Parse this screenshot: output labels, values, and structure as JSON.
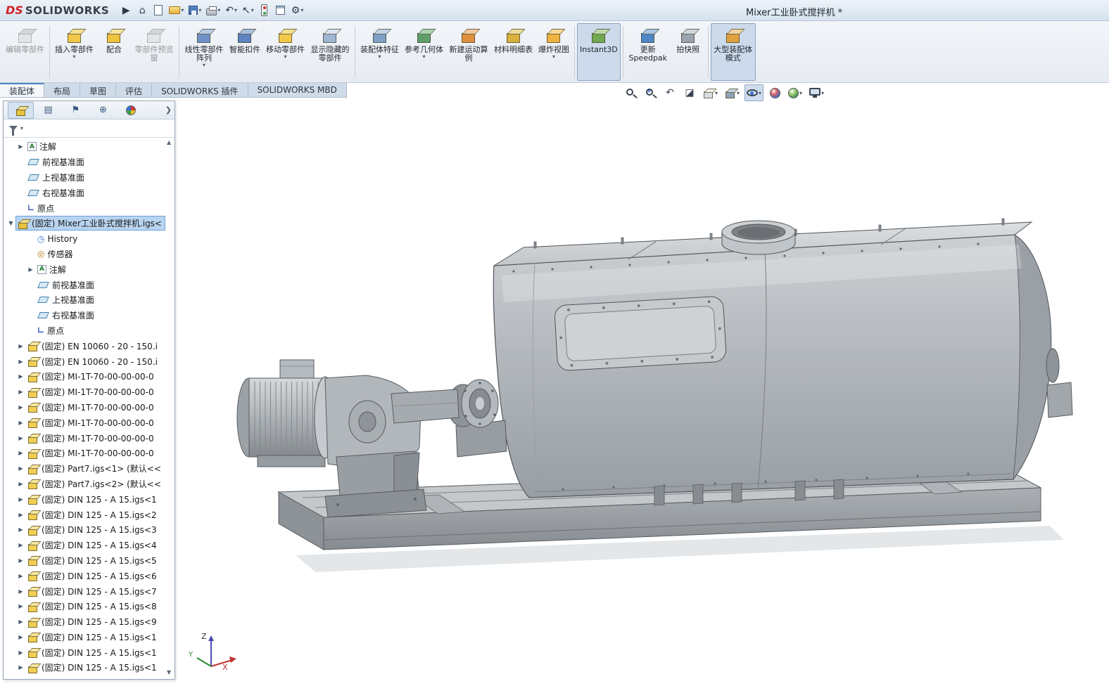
{
  "titlebar": {
    "brand_prefix": "DS",
    "brand": "SOLIDWORKS",
    "doc_title": "Mixer工业卧式搅拌机 *",
    "tools": [
      {
        "name": "toolbar-expand-icon",
        "type": "glyph",
        "g": "▶"
      },
      {
        "name": "home-icon",
        "type": "glyph",
        "g": "⌂"
      },
      {
        "name": "new-document-icon",
        "type": "doc"
      },
      {
        "name": "open-document-icon",
        "type": "folder",
        "caret": true
      },
      {
        "name": "save-icon",
        "type": "save",
        "caret": true
      },
      {
        "name": "print-icon",
        "type": "print",
        "caret": true
      },
      {
        "name": "undo-icon",
        "type": "glyph",
        "g": "↶",
        "caret": true
      },
      {
        "name": "select-icon",
        "type": "glyph",
        "g": "↖",
        "caret": true
      },
      {
        "name": "rebuild-icon",
        "type": "traffic"
      },
      {
        "name": "file-properties-icon",
        "type": "propbox"
      },
      {
        "name": "options-icon",
        "type": "glyph",
        "g": "⚙",
        "caret": true
      }
    ]
  },
  "icons": {
    "expand": "▶",
    "collapse": "▼",
    "caret": "▾",
    "scroll_up": "▲",
    "scroll_down": "▼"
  },
  "ribbon": {
    "separators": [
      0,
      3,
      7,
      12,
      13,
      15
    ],
    "buttons": [
      {
        "name": "edit-component-button",
        "label": "编辑零部件",
        "disabled": true,
        "c1": "#cfd6de",
        "c2": "#aab4c0"
      },
      {
        "name": "insert-components-button",
        "label": "插入零部件",
        "dropdown": true,
        "c1": "#f2c84b",
        "c2": "#f7e08e"
      },
      {
        "name": "mate-button",
        "label": "配合",
        "c1": "#f0c23e",
        "c2": "#f8e49a"
      },
      {
        "name": "component-preview-window-button",
        "label": "零部件预览窗",
        "disabled": true,
        "c1": "#cfd6de",
        "c2": "#aab4c0"
      },
      {
        "name": "linear-component-pattern-button",
        "label": "线性零部件阵列",
        "dropdown": true,
        "c1": "#6f93c9",
        "c2": "#b8cbe6"
      },
      {
        "name": "smart-fasteners-button",
        "label": "智能扣件",
        "c1": "#5c84c0",
        "c2": "#a9c0de"
      },
      {
        "name": "move-component-button",
        "label": "移动零部件",
        "dropdown": true,
        "c1": "#f2c84b",
        "c2": "#f7e08e"
      },
      {
        "name": "show-hidden-components-button",
        "label": "显示隐藏的零部件",
        "c1": "#9fb6d4",
        "c2": "#dce6f2"
      },
      {
        "name": "assembly-features-button",
        "label": "装配体特征",
        "dropdown": true,
        "c1": "#7f9fc7",
        "c2": "#c3d3e8"
      },
      {
        "name": "reference-geometry-button",
        "label": "参考几何体",
        "dropdown": true,
        "c1": "#5fa06a",
        "c2": "#abd3b1"
      },
      {
        "name": "new-motion-study-button",
        "label": "新建运动算例",
        "c1": "#e08f3c",
        "c2": "#f2c89a"
      },
      {
        "name": "bill-of-materials-button",
        "label": "材料明细表",
        "c1": "#d9b13a",
        "c2": "#efdc9a"
      },
      {
        "name": "exploded-view-button",
        "label": "爆炸视图",
        "dropdown": true,
        "c1": "#efb23f",
        "c2": "#f8d98f"
      },
      {
        "name": "instant3d-button",
        "label": "Instant3D",
        "active": true,
        "c1": "#72a84f",
        "c2": "#bcd9a6"
      },
      {
        "name": "update-speedpak-button",
        "label": "更新Speedpak",
        "c1": "#4f86c6",
        "c2": "#a9c6e4"
      },
      {
        "name": "take-snapshot-button",
        "label": "拍快照",
        "c1": "#9aa4ae",
        "c2": "#cfd6dd"
      },
      {
        "name": "large-assembly-mode-button",
        "label": "大型装配体模式",
        "active": true,
        "c1": "#e0a23c",
        "c2": "#f2d49a"
      }
    ]
  },
  "command_tabs": [
    {
      "name": "tab-assembly",
      "label": "装配体",
      "active": true
    },
    {
      "name": "tab-layout",
      "label": "布局"
    },
    {
      "name": "tab-sketch",
      "label": "草图"
    },
    {
      "name": "tab-evaluate",
      "label": "评估"
    },
    {
      "name": "tab-solidworks-addins",
      "label": "SOLIDWORKS 插件"
    },
    {
      "name": "tab-solidworks-mbd",
      "label": "SOLIDWORKS MBD"
    }
  ],
  "viewport": {
    "triad": {
      "x": "X",
      "y": "Y",
      "z": "Z"
    },
    "headsup": [
      {
        "name": "zoom-to-fit-icon",
        "icon": "mag"
      },
      {
        "name": "zoom-to-area-icon",
        "icon": "magplus"
      },
      {
        "name": "previous-view-icon",
        "icon": "glyph",
        "g": "↶"
      },
      {
        "name": "section-view-icon",
        "icon": "glyph",
        "g": "◪"
      },
      {
        "name": "view-orientation-icon",
        "icon": "cube",
        "caret": true,
        "c1": "#d8dee6",
        "c2": "#eef2f6"
      },
      {
        "name": "display-style-icon",
        "icon": "cube",
        "caret": true,
        "c1": "#8fa3b8",
        "c2": "#c6d4e2"
      },
      {
        "name": "hide-show-items-icon",
        "icon": "eye",
        "caret": true,
        "pressed": true
      },
      {
        "name": "edit-appearance-icon",
        "icon": "ball"
      },
      {
        "name": "apply-scene-icon",
        "icon": "scene",
        "caret": true
      },
      {
        "name": "view-settings-icon",
        "icon": "monitor",
        "caret": true
      }
    ]
  },
  "panel": {
    "chevron": "❯",
    "tabs": [
      {
        "name": "tab-featuremanager",
        "icon": "asmcube",
        "active": true
      },
      {
        "name": "tab-propertymanager",
        "icon": "glyph",
        "g": "▤"
      },
      {
        "name": "tab-configurationmanager",
        "icon": "glyph",
        "g": "⚑"
      },
      {
        "name": "tab-dimxpertmanager",
        "icon": "glyph",
        "g": "⊕"
      },
      {
        "name": "tab-displaymanager",
        "icon": "disp"
      }
    ],
    "tree": [
      {
        "label": "注解",
        "icon": "ann",
        "level": 1,
        "arrow": "r"
      },
      {
        "label": "前视基准面",
        "icon": "plane",
        "level": 1
      },
      {
        "label": "上视基准面",
        "icon": "plane",
        "level": 1
      },
      {
        "label": "右视基准面",
        "icon": "plane",
        "level": 1
      },
      {
        "label": "原点",
        "icon": "origin",
        "level": 1
      },
      {
        "label": "(固定) Mixer工业卧式搅拌机.igs<",
        "icon": "asm",
        "level": 0,
        "arrow": "d",
        "selected": true
      },
      {
        "label": "History",
        "icon": "hist",
        "level": 2
      },
      {
        "label": "传感器",
        "icon": "sensor",
        "level": 2
      },
      {
        "label": "注解",
        "icon": "ann",
        "level": 2,
        "arrow": "r"
      },
      {
        "label": "前视基准面",
        "icon": "plane",
        "level": 2
      },
      {
        "label": "上视基准面",
        "icon": "plane",
        "level": 2
      },
      {
        "label": "右视基准面",
        "icon": "plane",
        "level": 2
      },
      {
        "label": "原点",
        "icon": "origin",
        "level": 2
      },
      {
        "label": "(固定) EN 10060 - 20 - 150.i",
        "icon": "part",
        "level": 1,
        "arrow": "r"
      },
      {
        "label": "(固定) EN 10060 - 20 - 150.i",
        "icon": "part",
        "level": 1,
        "arrow": "r"
      },
      {
        "label": "(固定) MI-1T-70-00-00-00-0",
        "icon": "part",
        "level": 1,
        "arrow": "r"
      },
      {
        "label": "(固定) MI-1T-70-00-00-00-0",
        "icon": "part",
        "level": 1,
        "arrow": "r"
      },
      {
        "label": "(固定) MI-1T-70-00-00-00-0",
        "icon": "part",
        "level": 1,
        "arrow": "r"
      },
      {
        "label": "(固定) MI-1T-70-00-00-00-0",
        "icon": "part",
        "level": 1,
        "arrow": "r"
      },
      {
        "label": "(固定) MI-1T-70-00-00-00-0",
        "icon": "part",
        "level": 1,
        "arrow": "r"
      },
      {
        "label": "(固定) MI-1T-70-00-00-00-0",
        "icon": "part",
        "level": 1,
        "arrow": "r"
      },
      {
        "label": "(固定) Part7.igs<1> (默认<<",
        "icon": "part",
        "level": 1,
        "arrow": "r"
      },
      {
        "label": "(固定) Part7.igs<2> (默认<<",
        "icon": "part",
        "level": 1,
        "arrow": "r"
      },
      {
        "label": "(固定) DIN 125 - A 15.igs<1",
        "icon": "part",
        "level": 1,
        "arrow": "r"
      },
      {
        "label": "(固定) DIN 125 - A 15.igs<2",
        "icon": "part",
        "level": 1,
        "arrow": "r"
      },
      {
        "label": "(固定) DIN 125 - A 15.igs<3",
        "icon": "part",
        "level": 1,
        "arrow": "r"
      },
      {
        "label": "(固定) DIN 125 - A 15.igs<4",
        "icon": "part",
        "level": 1,
        "arrow": "r"
      },
      {
        "label": "(固定) DIN 125 - A 15.igs<5",
        "icon": "part",
        "level": 1,
        "arrow": "r"
      },
      {
        "label": "(固定) DIN 125 - A 15.igs<6",
        "icon": "part",
        "level": 1,
        "arrow": "r"
      },
      {
        "label": "(固定) DIN 125 - A 15.igs<7",
        "icon": "part",
        "level": 1,
        "arrow": "r"
      },
      {
        "label": "(固定) DIN 125 - A 15.igs<8",
        "icon": "part",
        "level": 1,
        "arrow": "r"
      },
      {
        "label": "(固定) DIN 125 - A 15.igs<9",
        "icon": "part",
        "level": 1,
        "arrow": "r"
      },
      {
        "label": "(固定) DIN 125 - A 15.igs<1",
        "icon": "part",
        "level": 1,
        "arrow": "r"
      },
      {
        "label": "(固定) DIN 125 - A 15.igs<1",
        "icon": "part",
        "level": 1,
        "arrow": "r"
      },
      {
        "label": "(固定) DIN 125 - A 15.igs<1",
        "icon": "part",
        "level": 1,
        "arrow": "r"
      }
    ]
  }
}
